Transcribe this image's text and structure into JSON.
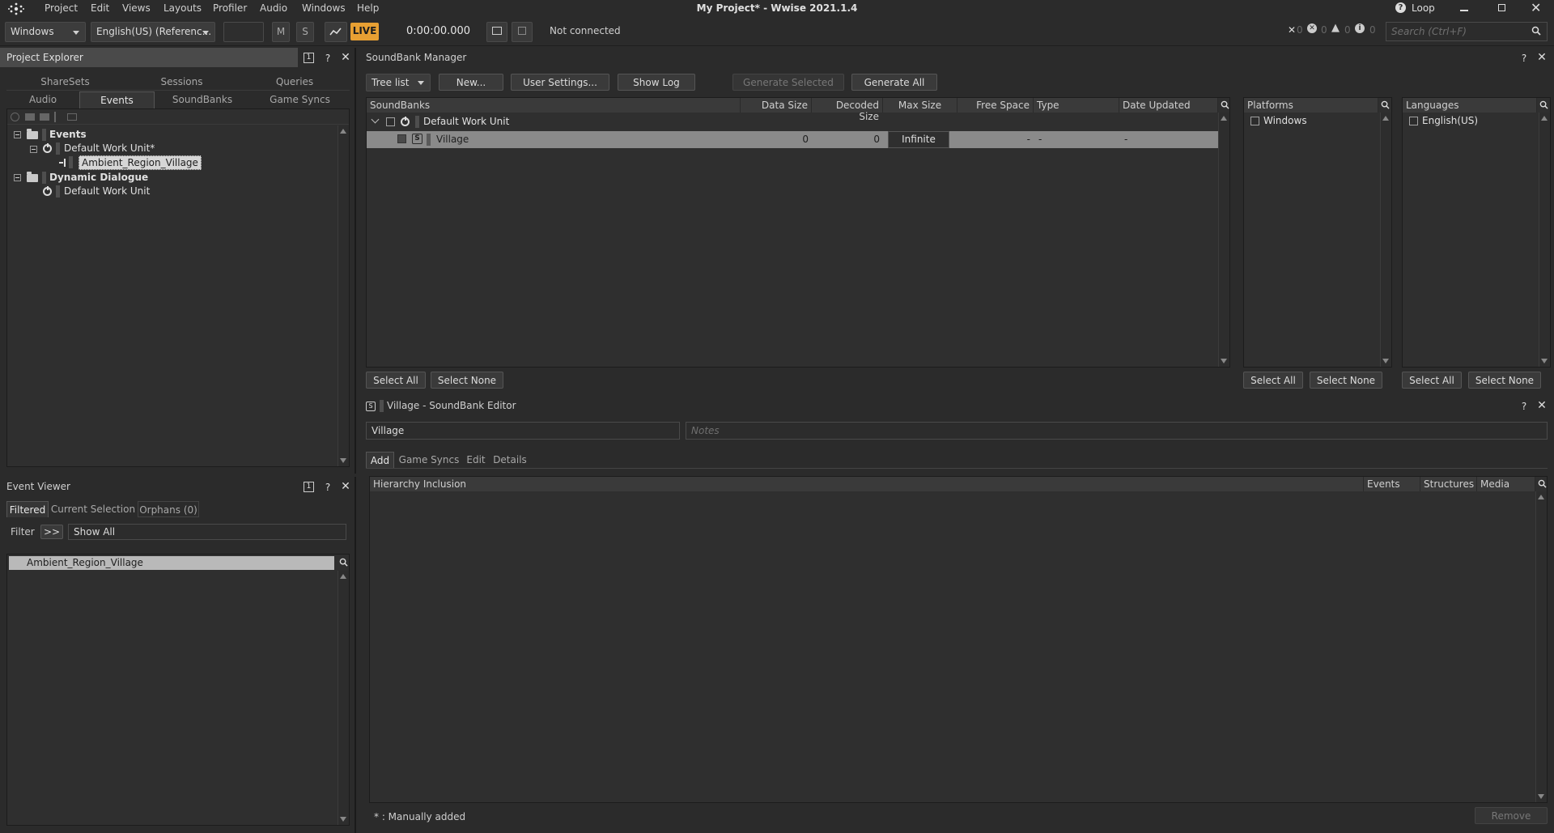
{
  "app": {
    "title": "My Project* - Wwise 2021.1.4",
    "menu": [
      "Project",
      "Edit",
      "Views",
      "Layouts",
      "Profiler",
      "Audio",
      "Windows",
      "Help"
    ],
    "loop_label": "Loop"
  },
  "toolbar": {
    "platform": "Windows",
    "language": "English(US) (Referenc...",
    "mute_label": "M",
    "solo_label": "S",
    "live_label": "LIVE",
    "time": "0:00:00.000",
    "connection": "Not connected",
    "counts": [
      "0",
      "0",
      "0",
      "0"
    ],
    "search_placeholder": "Search (Ctrl+F)",
    "colors": {
      "live": "#e8a033"
    }
  },
  "project_explorer": {
    "title": "Project Explorer",
    "badge": "1",
    "tabs_row1": [
      "ShareSets",
      "Sessions",
      "Queries"
    ],
    "tabs_row2": [
      "Audio",
      "Events",
      "SoundBanks",
      "Game Syncs"
    ],
    "active_tab": "Events",
    "tree": {
      "events_label": "Events",
      "default_wu": "Default Work Unit*",
      "event_item": "Ambient_Region_Village",
      "dynamic_dialogue": "Dynamic Dialogue",
      "dd_default_wu": "Default Work Unit"
    }
  },
  "event_viewer": {
    "title": "Event Viewer",
    "badge": "1",
    "tabs": [
      "Filtered",
      "Current Selection",
      "Orphans (0)"
    ],
    "filter_label": "Filter",
    "filter_btn": ">>",
    "filter_value": "Show All",
    "items": [
      "Ambient_Region_Village"
    ]
  },
  "soundbank_manager": {
    "title": "SoundBank Manager",
    "view_mode": "Tree list",
    "buttons": {
      "new": "New...",
      "user_settings": "User Settings...",
      "show_log": "Show Log",
      "generate_selected": "Generate Selected",
      "generate_all": "Generate All"
    },
    "columns": [
      "SoundBanks",
      "Data Size",
      "Decoded Size",
      "Max Size",
      "Free Space",
      "Type",
      "Date Updated"
    ],
    "work_unit": "Default Work Unit",
    "rows": [
      {
        "name": "Village",
        "data_size": "0",
        "decoded_size": "0",
        "max_size": "Infinite",
        "free_space": "-",
        "type": "-",
        "date_updated": "-"
      }
    ],
    "select_all": "Select All",
    "select_none": "Select None",
    "platforms": {
      "header": "Platforms",
      "items": [
        "Windows"
      ],
      "select_all": "Select All",
      "select_none": "Select None"
    },
    "languages": {
      "header": "Languages",
      "items": [
        "English(US)"
      ],
      "select_all": "Select All",
      "select_none": "Select None"
    }
  },
  "soundbank_editor": {
    "title": "Village - SoundBank Editor",
    "name_value": "Village",
    "notes_placeholder": "Notes",
    "tabs": [
      "Add",
      "Game Syncs",
      "Edit",
      "Details"
    ],
    "active_tab": "Add",
    "columns": [
      "Hierarchy Inclusion",
      "Events",
      "Structures",
      "Media"
    ],
    "footer_note": "* : Manually added",
    "remove_label": "Remove"
  }
}
